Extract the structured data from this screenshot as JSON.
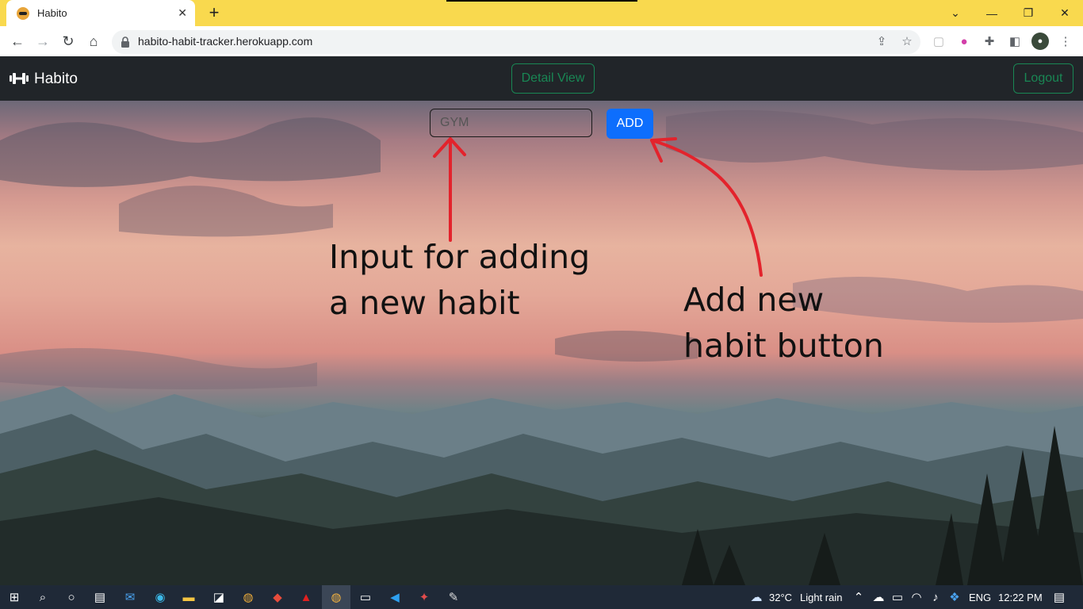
{
  "browser": {
    "tab_title": "Habito",
    "url": "habito-habit-tracker.herokuapp.com"
  },
  "navbar": {
    "brand": "Habito",
    "detail_view_label": "Detail View",
    "logout_label": "Logout"
  },
  "form": {
    "input_placeholder": "GYM",
    "add_label": "ADD"
  },
  "annotations": {
    "input_note": "Input for adding a new habit",
    "button_note": "Add new habit button"
  },
  "taskbar": {
    "weather_temp": "32°C",
    "weather_desc": "Light rain",
    "language": "ENG",
    "time": "12:22 PM"
  },
  "colors": {
    "chrome_tab_strip": "#f9d94e",
    "navbar": "#212529",
    "outline_success": "#198754",
    "primary": "#0d6efd",
    "annotation_arrow": "#e3232c"
  }
}
